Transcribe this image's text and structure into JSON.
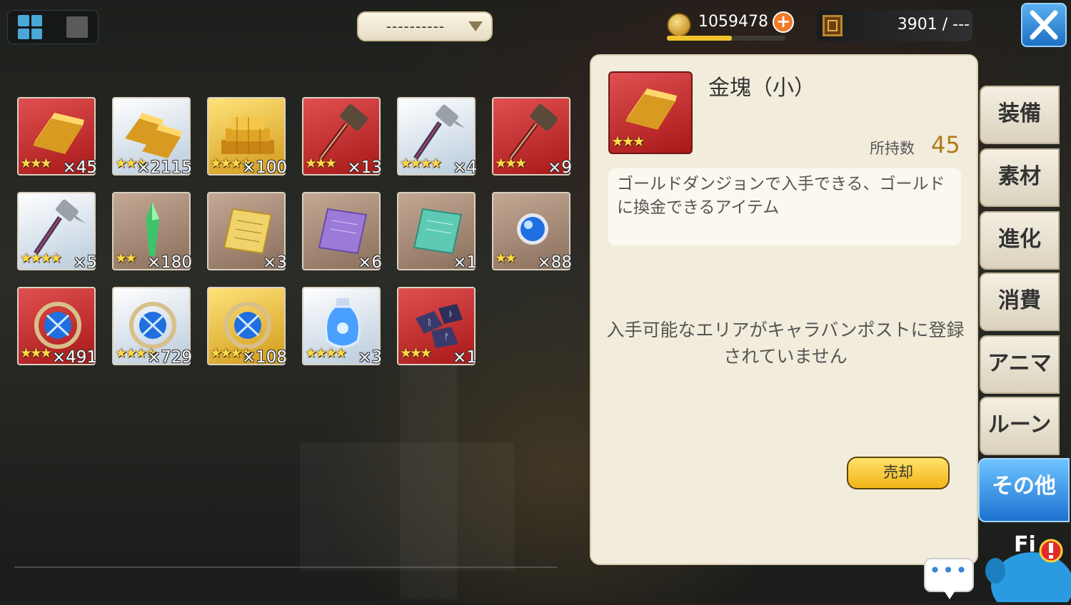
{
  "header": {
    "filter_value": "----------",
    "gold": "1059478",
    "gold_bar_fraction": 0.55,
    "capacity": "3901 / ---"
  },
  "items": [
    {
      "icon": "gold-bar-icon",
      "frame": "red",
      "stars": "★★★",
      "count": "×45"
    },
    {
      "icon": "gold-bars-icon",
      "frame": "silver",
      "stars": "★★★",
      "count": "×2115"
    },
    {
      "icon": "gold-pile-icon",
      "frame": "gold",
      "stars": "★★★★",
      "count": "×100"
    },
    {
      "icon": "hammer-icon",
      "frame": "red",
      "stars": "★★★",
      "count": "×13"
    },
    {
      "icon": "pick-hammer-icon",
      "frame": "silver",
      "stars": "★★★★",
      "count": "×4"
    },
    {
      "icon": "hammer-icon",
      "frame": "red",
      "stars": "★★★",
      "count": "×9"
    },
    {
      "icon": "pick-hammer-icon",
      "frame": "silver",
      "stars": "★★★★",
      "count": "×5"
    },
    {
      "icon": "green-spear-icon",
      "frame": "brown",
      "stars": "★★",
      "count": "×180"
    },
    {
      "icon": "gold-ticket-icon",
      "frame": "brown",
      "stars": "",
      "count": "×3"
    },
    {
      "icon": "purple-ticket-icon",
      "frame": "brown",
      "stars": "",
      "count": "×6"
    },
    {
      "icon": "teal-ticket-icon",
      "frame": "brown",
      "stars": "",
      "count": "×1"
    },
    {
      "icon": "blue-orb-icon",
      "frame": "brown",
      "stars": "★★",
      "count": "×88"
    },
    {
      "icon": "ring-orb-icon",
      "frame": "red",
      "stars": "★★★",
      "count": "×491"
    },
    {
      "icon": "ring-orb-icon",
      "frame": "silver",
      "stars": "★★★★",
      "count": "×729"
    },
    {
      "icon": "ring-orb-icon",
      "frame": "gold",
      "stars": "★★★★",
      "count": "×108"
    },
    {
      "icon": "potion-vase-icon",
      "frame": "silver",
      "stars": "★★★★",
      "count": "×3"
    },
    {
      "icon": "rune-stones-icon",
      "frame": "red",
      "stars": "★★★",
      "count": "×1"
    }
  ],
  "detail": {
    "name": "金塊（小）",
    "stars": "★★★",
    "own_label": "所持数",
    "own_value": "45",
    "description": "ゴールドダンジョンで入手できる、ゴールドに換金できるアイテム",
    "area_message": "入手可能なエリアがキャラバンポストに登録されていません",
    "sell_label": "売却"
  },
  "tabs": [
    {
      "label": "装備",
      "active": false
    },
    {
      "label": "素材",
      "active": false
    },
    {
      "label": "進化",
      "active": false
    },
    {
      "label": "消費",
      "active": false
    },
    {
      "label": "アニマ",
      "active": false
    },
    {
      "label": "ルーン",
      "active": false
    },
    {
      "label": "その他",
      "active": true
    }
  ],
  "chat_label": "•••",
  "mascot_text": "Fi"
}
